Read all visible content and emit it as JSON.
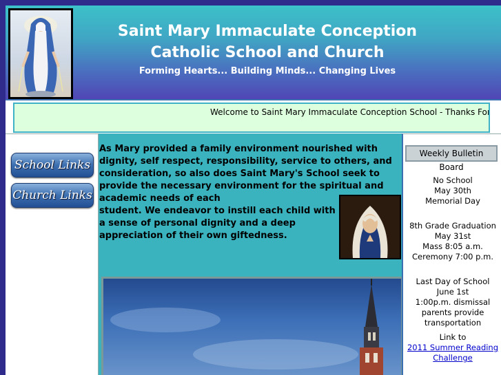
{
  "header": {
    "title_line1": "Saint Mary Immaculate Conception",
    "title_line2": "Catholic School and Church",
    "tagline": "Forming Hearts... Building Minds... Changing Lives"
  },
  "marquee": {
    "text": "Welcome to Saint Mary Immaculate Conception School - Thanks For a C"
  },
  "nav": {
    "school_links": "School Links",
    "church_links": "Church Links"
  },
  "main": {
    "intro_part1": "As Mary provided a family environment nourished with dignity, self respect, responsibility, service to others, and consideration, so also does Saint Mary's School seek to provide the necessary environment for the spiritual and academic needs of each",
    "intro_part2": "student. We  endeavor to instill each child with a sense of personal dignity and a deep appreciation of their own giftedness."
  },
  "bulletin": {
    "title": "Weekly Bulletin Board",
    "events": [
      {
        "lines": [
          "No School",
          "May 30th",
          "Memorial Day"
        ]
      },
      {
        "lines": [
          "8th Grade Graduation",
          "May 31st",
          "Mass 8:05 a.m.",
          "Ceremony 7:00 p.m."
        ]
      },
      {
        "lines": [
          "Last Day of School",
          "June 1st",
          "1:00p.m. dismissal",
          "parents provide",
          "transportation"
        ]
      }
    ],
    "link_prefix": "Link to",
    "link_text": "2011 Summer Reading Challenge"
  },
  "colors": {
    "page_background": "#2e2b8c",
    "header_top": "#3cc1c9",
    "header_bottom": "#5046b5",
    "content_teal": "#3bb3be",
    "marquee_background": "#ddffdd",
    "link": "#0000cc"
  }
}
